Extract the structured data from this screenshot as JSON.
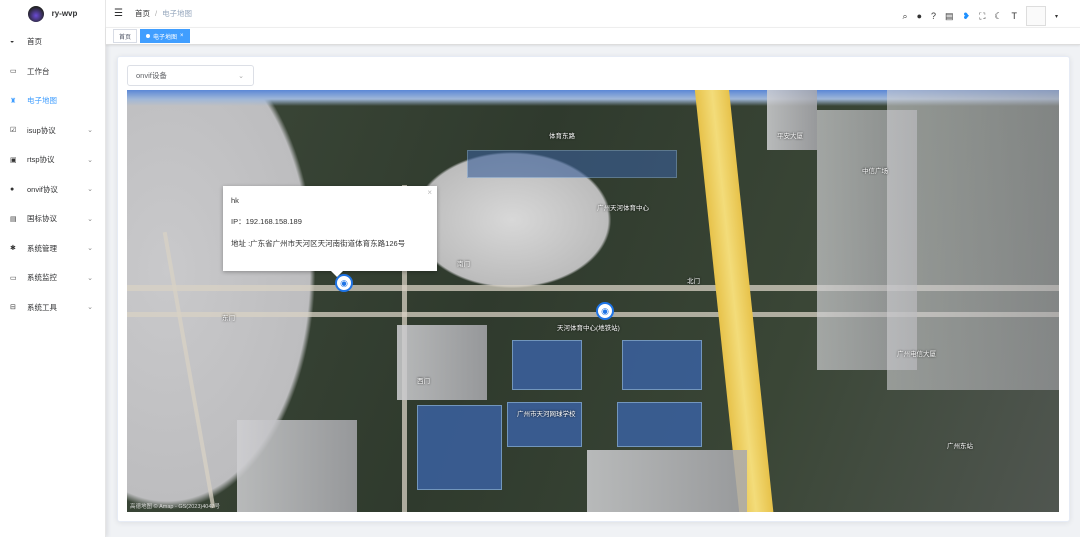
{
  "app": {
    "name": "ry-wvp"
  },
  "sidebar": {
    "items": [
      {
        "label": "首页",
        "icon": "dashboard-icon"
      },
      {
        "label": "工作台",
        "icon": "monitor-icon"
      },
      {
        "label": "电子地图",
        "icon": "map-icon",
        "active": true
      },
      {
        "label": "isup协议",
        "icon": "checkbox-icon",
        "expandable": true
      },
      {
        "label": "rtsp协议",
        "icon": "video-icon",
        "expandable": true
      },
      {
        "label": "onvif协议",
        "icon": "camera-icon",
        "expandable": true
      },
      {
        "label": "国标协议",
        "icon": "list-icon",
        "expandable": true
      },
      {
        "label": "系统管理",
        "icon": "gear-icon",
        "expandable": true
      },
      {
        "label": "系统监控",
        "icon": "monitor-icon",
        "expandable": true
      },
      {
        "label": "系统工具",
        "icon": "toolbox-icon",
        "expandable": true
      }
    ]
  },
  "header": {
    "breadcrumb": [
      "首页",
      "电子地图"
    ],
    "separator": "/"
  },
  "tags": [
    {
      "label": "首页"
    },
    {
      "label": "电子地图",
      "active": true,
      "close": "×"
    }
  ],
  "filter": {
    "selected": "onvif设备"
  },
  "map": {
    "labels": [
      "体育东路",
      "广州天河体育中心",
      "中信广场",
      "平安大厦",
      "广州电信大厦",
      "广州市天河网球学校",
      "广州东站",
      "东门",
      "西门",
      "南门",
      "北门",
      "天河体育中心(地铁站)"
    ],
    "attribution": "高德地图 © Amap - GS(2023)4047号"
  },
  "popup": {
    "name": "hk",
    "ip": "IP：192.168.158.189",
    "address": "地址 :广东省广州市天河区天河南街道体育东路126号",
    "close": "×"
  },
  "colors": {
    "accent": "#409eff"
  }
}
